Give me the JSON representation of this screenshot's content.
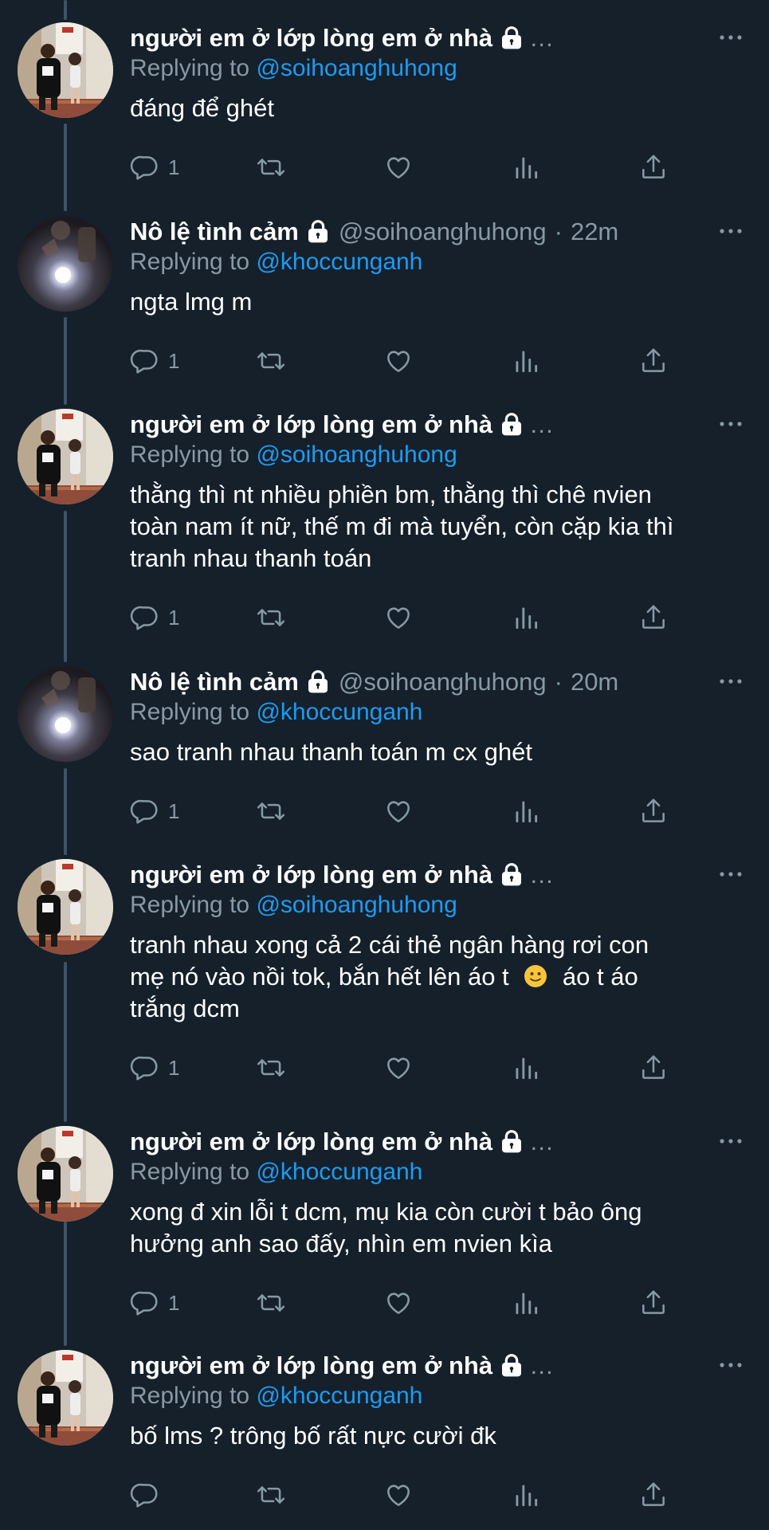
{
  "colors": {
    "background": "#15202b",
    "text": "#ffffff",
    "muted": "#8899a6",
    "link": "#1d9bf0",
    "thread_line": "#3d5466"
  },
  "labels": {
    "replying_to": "Replying to",
    "ellipsis": "…",
    "separator": "·"
  },
  "tweets": [
    {
      "name": "người em ở lớp lòng em ở nhà",
      "handle": "",
      "time": "",
      "reply_to": "@soihoanghuhong",
      "lines": [
        "đáng để ghét"
      ],
      "reply_count": "1",
      "avatar": "couple-photo"
    },
    {
      "name": "Nô lệ tình cảm",
      "handle": "@soihoanghuhong",
      "time": "22m",
      "reply_to": "@khoccunganh",
      "lines": [
        "ngta lmg m"
      ],
      "reply_count": "1",
      "avatar": "flash-photo"
    },
    {
      "name": "người em ở lớp lòng em ở nhà",
      "handle": "",
      "time": "",
      "reply_to": "@soihoanghuhong",
      "lines": [
        "thằng thì nt nhiều phiền bm, thằng thì  chê nvien",
        "toàn nam ít nữ, thế m đi mà tuyển, còn cặp kia thì",
        "tranh nhau thanh toán"
      ],
      "reply_count": "1",
      "avatar": "couple-photo"
    },
    {
      "name": "Nô lệ tình cảm",
      "handle": "@soihoanghuhong",
      "time": "20m",
      "reply_to": "@khoccunganh",
      "lines": [
        "sao tranh nhau thanh toán m cx ghét"
      ],
      "reply_count": "1",
      "avatar": "flash-photo"
    },
    {
      "name": "người em ở lớp lòng em ở nhà",
      "handle": "",
      "time": "",
      "reply_to": "@soihoanghuhong",
      "lines": [
        "tranh nhau xong cả 2 cái thẻ ngân hàng rơi con",
        "mẹ nó vào nồi tok, bắn hết lên áo t [emoji] áo t áo",
        "trắng dcm"
      ],
      "reply_count": "1",
      "avatar": "couple-photo"
    },
    {
      "name": "người em ở lớp lòng em ở nhà",
      "handle": "",
      "time": "",
      "reply_to": "@khoccunganh",
      "lines": [
        "xong đ xin lỗi t dcm, mụ kia còn cười t bảo ông",
        "hưởng anh sao đấy, nhìn em nvien kìa"
      ],
      "reply_count": "1",
      "avatar": "couple-photo"
    },
    {
      "name": "người em ở lớp lòng em ở nhà",
      "handle": "",
      "time": "",
      "reply_to": "@khoccunganh",
      "lines": [
        "bố lms ? trông bố rất nực cười đk"
      ],
      "reply_count": "",
      "avatar": "couple-photo"
    }
  ]
}
